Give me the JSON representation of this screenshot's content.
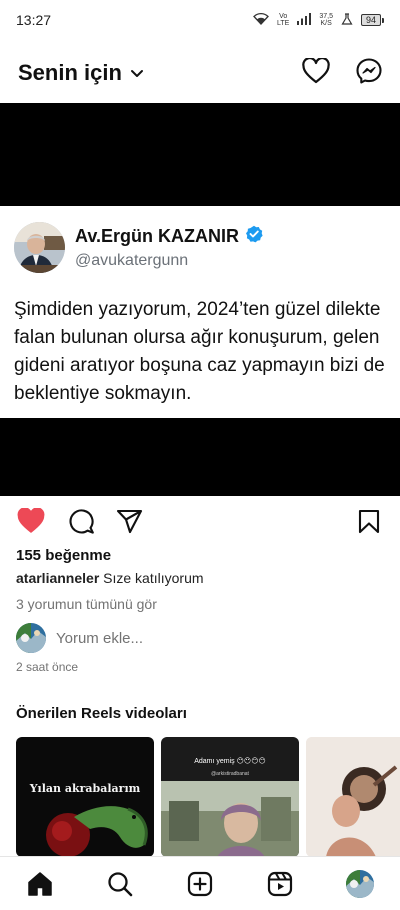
{
  "status_bar": {
    "time": "13:27",
    "net_type_top": "Vo",
    "net_type_bottom": "LTE",
    "speed_value": "37,5",
    "speed_unit": "K/S",
    "battery": "94"
  },
  "header": {
    "title": "Senin için",
    "icons": [
      "chevron-down-icon",
      "heart-icon",
      "messenger-icon"
    ]
  },
  "post": {
    "author_name": "Av.Ergün KAZANIR",
    "author_handle": "@avukatergunn",
    "verified": true,
    "tweet_text": "Şimdiden yazıyorum, 2024’ten güzel dilekte falan bulunan olursa ağır konuşurum, gelen gideni aratıyor boşuna caz yapmayın bizi de beklentiye sokmayın.",
    "liked": true,
    "likes_text": "155 beğenme",
    "caption_user": "atarlianneler",
    "caption_text": "Sıze katılıyorum",
    "view_comments": "3 yorumun tümünü gör",
    "comment_placeholder": "Yorum ekle...",
    "time_ago": "2 saat önce"
  },
  "reels": {
    "title": "Önerilen Reels videoları",
    "items": [
      {
        "caption": "Yılan akrabalarım"
      },
      {
        "caption": "Adamı yemiş 😶😶😶😶",
        "tag": "@arkistiradbanat"
      },
      {
        "caption": ""
      }
    ]
  },
  "bottom_nav": {
    "items": [
      "home-icon",
      "search-icon",
      "create-icon",
      "reels-icon",
      "profile-avatar"
    ],
    "active": "home-icon"
  },
  "colors": {
    "like_red": "#ed4956",
    "verified_blue": "#1d9bf0",
    "muted_gray": "#737373",
    "handle_gray": "#6b7178"
  }
}
